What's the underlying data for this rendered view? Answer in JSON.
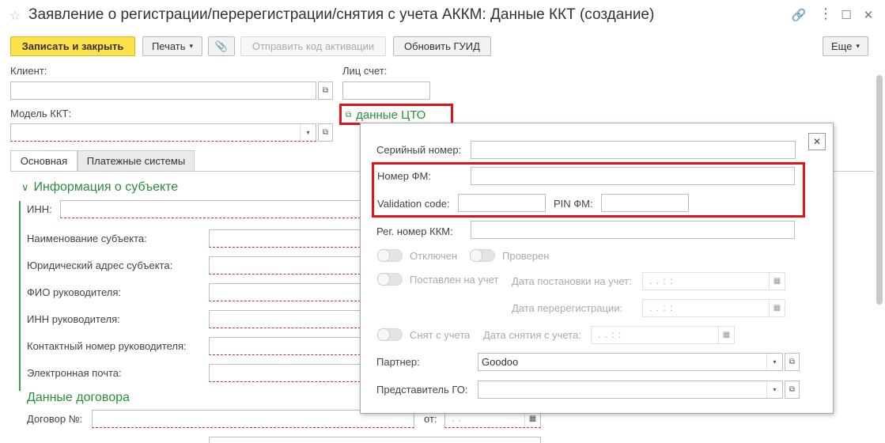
{
  "window": {
    "title": "Заявление о регистрации/перерегистрации/снятия с учета АККМ: Данные ККТ (создание)"
  },
  "toolbar": {
    "save_close": "Записать и закрыть",
    "print": "Печать",
    "send_code": "Отправить код активации",
    "update_guid": "Обновить ГУИД",
    "more": "Еще"
  },
  "form": {
    "client_label": "Клиент:",
    "account_label": "Лиц счет:",
    "model_label": "Модель ККТ:",
    "cto_link": "данные ЦТО"
  },
  "tabs": [
    {
      "label": "Основная"
    },
    {
      "label": "Платежные системы"
    }
  ],
  "subject": {
    "header": "Информация о субъекте",
    "inn_label": "ИНН:",
    "name_label": "Наименование субъекта:",
    "address_label": "Юридический адрес субъекта:",
    "head_fio_label": "ФИО руководителя:",
    "head_inn_label": "ИНН руководителя:",
    "head_phone_label": "Контактный номер руководителя:",
    "email_label": "Электронная почта:"
  },
  "contract": {
    "header": "Данные договора",
    "number_label": "Договор №:",
    "from_label": "от:",
    "date_value": ". ."
  },
  "popup": {
    "serial_label": "Серийный номер:",
    "fm_label": "Номер ФМ:",
    "validation_label": "Validation code:",
    "pin_label": "PIN ФМ:",
    "reg_label": "Рег. номер ККМ:",
    "disabled_label": "Отключен",
    "checked_label": "Проверен",
    "registered_label": "Поставлен на учет",
    "reg_date_label": "Дата постановки на учет:",
    "rereg_date_label": "Дата перерегистрации:",
    "removed_label": "Снят с учета",
    "remove_date_label": "Дата снятия с учета:",
    "date_placeholder": ".  .     :  :",
    "partner_label": "Партнер:",
    "partner_value": "Goodoo",
    "go_label": "Представитель ГО:"
  },
  "colors": {
    "accent_green": "#2c8c3c",
    "primary_yellow": "#fbe14a",
    "highlight_red": "#e0141b"
  }
}
